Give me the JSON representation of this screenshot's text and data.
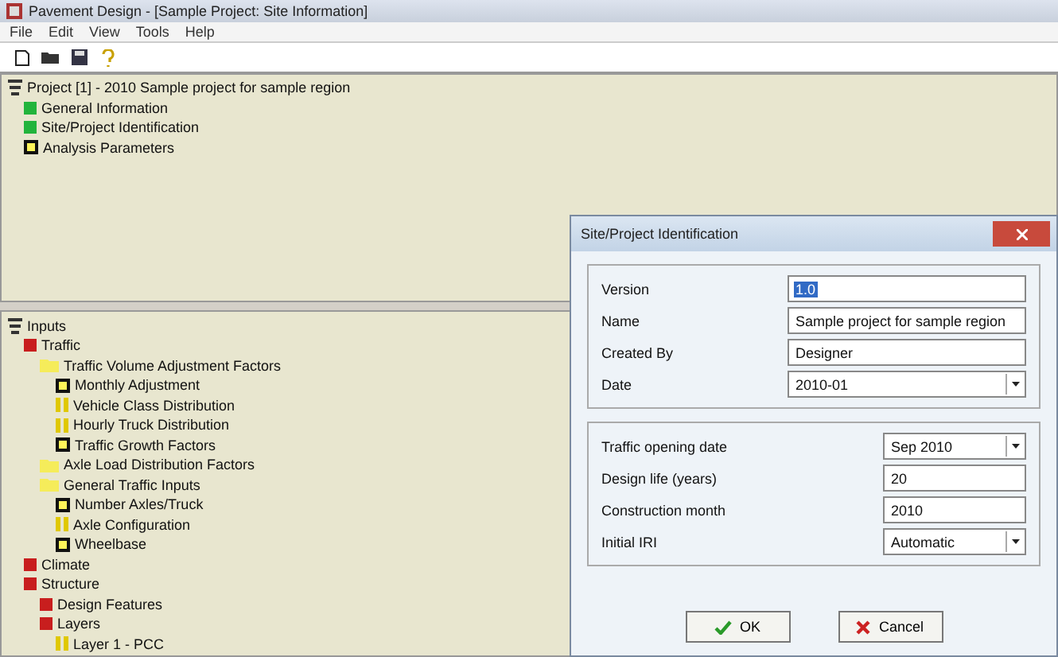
{
  "window": {
    "title": "Pavement Design - [Sample Project: Site Information]"
  },
  "menu": [
    "File",
    "Edit",
    "View",
    "Tools",
    "Help"
  ],
  "toolbar": [
    {
      "kind": "new"
    },
    {
      "kind": "open"
    },
    {
      "kind": "save"
    },
    {
      "kind": "help"
    }
  ],
  "top_tree": {
    "label": "Project [1] - 2010 Sample project for sample region",
    "children": [
      {
        "label": "General Information",
        "kind": "green"
      },
      {
        "label": "Site/Project Identification",
        "kind": "green"
      },
      {
        "label": "Analysis Parameters",
        "kind": "outline"
      }
    ]
  },
  "bottom_tree": {
    "label": "Inputs",
    "children": [
      {
        "label": "Traffic",
        "kind": "red",
        "children": [
          {
            "label": "Traffic Volume Adjustment Factors",
            "kind": "folder",
            "children": [
              {
                "label": "Monthly Adjustment",
                "kind": "outline"
              },
              {
                "label": "Vehicle Class Distribution",
                "kind": "bars"
              },
              {
                "label": "Hourly Truck Distribution",
                "kind": "bars"
              },
              {
                "label": "Traffic Growth Factors",
                "kind": "outline"
              }
            ]
          },
          {
            "label": "Axle Load Distribution Factors",
            "kind": "folder"
          },
          {
            "label": "General Traffic Inputs",
            "kind": "folder",
            "children": [
              {
                "label": "Number Axles/Truck",
                "kind": "outline"
              },
              {
                "label": "Axle Configuration",
                "kind": "bars"
              },
              {
                "label": "Wheelbase",
                "kind": "outline"
              }
            ]
          }
        ]
      },
      {
        "label": "Climate",
        "kind": "red"
      },
      {
        "label": "Structure",
        "kind": "red",
        "children": [
          {
            "label": "Design Features",
            "kind": "red"
          },
          {
            "label": "Layers",
            "kind": "red",
            "children": [
              {
                "label": "Layer 1 - PCC",
                "kind": "bars"
              }
            ]
          }
        ]
      }
    ]
  },
  "dialog": {
    "title": "Site/Project Identification",
    "fields": [
      {
        "label": "Version",
        "value": "1.0",
        "kind": "text",
        "selected": true
      },
      {
        "label": "Name",
        "value": "Sample project for sample region",
        "kind": "text",
        "selected": false
      },
      {
        "label": "Created By",
        "value": "Designer",
        "kind": "text",
        "selected": false
      },
      {
        "label": "Date",
        "value": "2010-01",
        "kind": "dropdown",
        "selected": false
      }
    ],
    "fields_2": [
      {
        "label": "Traffic opening date",
        "value": "Sep 2010",
        "kind": "dropdown"
      },
      {
        "label": "Design life (years)",
        "value": "20",
        "kind": "text"
      },
      {
        "label": "Construction month",
        "value": "2010",
        "kind": "text"
      },
      {
        "label": "Initial IRI",
        "value": "Automatic",
        "kind": "dropdown"
      }
    ],
    "buttons": [
      {
        "label": "OK",
        "kind": "confirm"
      },
      {
        "label": "Cancel",
        "kind": "cancel"
      }
    ]
  }
}
